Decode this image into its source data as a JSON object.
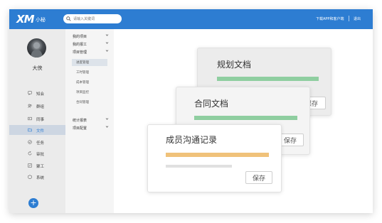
{
  "header": {
    "logo_main": "XM",
    "logo_sub": "小秘",
    "download_link": "下载APP和客户端",
    "logout_link": "退出",
    "colors": {
      "topbar": "#2d7dd2"
    }
  },
  "search": {
    "placeholder": "请输入关键词",
    "icon": "search-icon"
  },
  "user": {
    "name": "大侠"
  },
  "sidebar": {
    "items": [
      {
        "label": "知会",
        "icon": "chat-icon"
      },
      {
        "label": "群组",
        "icon": "group-icon"
      },
      {
        "label": "同事",
        "icon": "contact-card-icon"
      },
      {
        "label": "文件",
        "icon": "folder-icon",
        "active": true
      },
      {
        "label": "任务",
        "icon": "task-icon"
      },
      {
        "label": "审批",
        "icon": "approval-icon"
      },
      {
        "label": "聚工",
        "icon": "tool-icon"
      },
      {
        "label": "系统",
        "icon": "system-icon"
      }
    ],
    "add_label": "+"
  },
  "submenu": {
    "groups": [
      {
        "label": "我的项目"
      },
      {
        "label": "我的报工"
      },
      {
        "label": "项目管理"
      },
      {
        "label": "统计报表"
      },
      {
        "label": "项目配置"
      }
    ],
    "leaves": [
      {
        "label": "进度管理",
        "active": true
      },
      {
        "label": "工时管理"
      },
      {
        "label": "成本管理"
      },
      {
        "label": "项目监控"
      },
      {
        "label": "合同管理"
      }
    ]
  },
  "documents": [
    {
      "title": "规划文档",
      "bar_color": "#8fcea0",
      "save_label": "保存"
    },
    {
      "title": "合同文档",
      "bar_color": "#8fcea0",
      "save_label": "保存"
    },
    {
      "title": "成员沟通记录",
      "bar_color": "#f0c27a",
      "save_label": "保存"
    }
  ]
}
